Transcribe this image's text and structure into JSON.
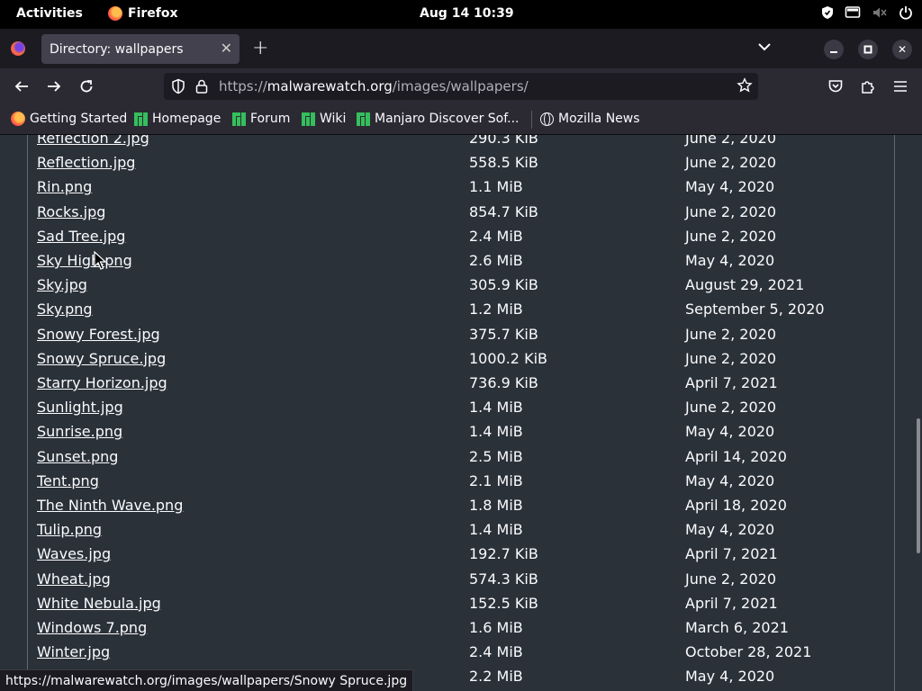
{
  "topbar": {
    "activities": "Activities",
    "app_name": "Firefox",
    "clock": "Aug 14  10:39",
    "tray_icons": [
      "shield-icon",
      "screen-icon",
      "muted-speaker-icon",
      "power-icon"
    ]
  },
  "tabs": [
    {
      "title": "Directory: wallpapers",
      "active": true
    }
  ],
  "navbar": {
    "url_prefix": "https://",
    "url_host": "malwarewatch.org",
    "url_path": "/images/wallpapers/"
  },
  "bookmarks": [
    {
      "label": "Getting Started",
      "icon": "firefox-icon"
    },
    {
      "label": "Homepage",
      "icon": "manjaro-icon"
    },
    {
      "label": "Forum",
      "icon": "manjaro-icon"
    },
    {
      "label": "Wiki",
      "icon": "manjaro-icon"
    },
    {
      "label": "Manjaro Discover Sof...",
      "icon": "manjaro-icon"
    },
    {
      "label": "Mozilla News",
      "icon": "globe-icon"
    }
  ],
  "files": [
    {
      "name": "Reflection 2.jpg",
      "size": "290.3 KiB",
      "date": "June 2, 2020"
    },
    {
      "name": "Reflection.jpg",
      "size": "558.5 KiB",
      "date": "June 2, 2020"
    },
    {
      "name": "Rin.png",
      "size": "1.1 MiB",
      "date": "May 4, 2020"
    },
    {
      "name": "Rocks.jpg",
      "size": "854.7 KiB",
      "date": "June 2, 2020"
    },
    {
      "name": "Sad Tree.jpg",
      "size": "2.4 MiB",
      "date": "June 2, 2020"
    },
    {
      "name": "Sky High.png",
      "size": "2.6 MiB",
      "date": "May 4, 2020"
    },
    {
      "name": "Sky.jpg",
      "size": "305.9 KiB",
      "date": "August 29, 2021"
    },
    {
      "name": "Sky.png",
      "size": "1.2 MiB",
      "date": "September 5, 2020"
    },
    {
      "name": "Snowy Forest.jpg",
      "size": "375.7 KiB",
      "date": "June 2, 2020"
    },
    {
      "name": "Snowy Spruce.jpg",
      "size": "1000.2 KiB",
      "date": "June 2, 2020"
    },
    {
      "name": "Starry Horizon.jpg",
      "size": "736.9 KiB",
      "date": "April 7, 2021"
    },
    {
      "name": "Sunlight.jpg",
      "size": "1.4 MiB",
      "date": "June 2, 2020"
    },
    {
      "name": "Sunrise.png",
      "size": "1.4 MiB",
      "date": "May 4, 2020"
    },
    {
      "name": "Sunset.png",
      "size": "2.5 MiB",
      "date": "April 14, 2020"
    },
    {
      "name": "Tent.png",
      "size": "2.1 MiB",
      "date": "May 4, 2020"
    },
    {
      "name": "The Ninth Wave.png",
      "size": "1.8 MiB",
      "date": "April 18, 2020"
    },
    {
      "name": "Tulip.png",
      "size": "1.4 MiB",
      "date": "May 4, 2020"
    },
    {
      "name": "Waves.jpg",
      "size": "192.7 KiB",
      "date": "April 7, 2021"
    },
    {
      "name": "Wheat.jpg",
      "size": "574.3 KiB",
      "date": "June 2, 2020"
    },
    {
      "name": "White Nebula.jpg",
      "size": "152.5 KiB",
      "date": "April 7, 2021"
    },
    {
      "name": "Windows 7.png",
      "size": "1.6 MiB",
      "date": "March 6, 2021"
    },
    {
      "name": "Winter.jpg",
      "size": "2.4 MiB",
      "date": "October 28, 2021"
    },
    {
      "name": "",
      "size": "2.2 MiB",
      "date": "May 4, 2020"
    }
  ],
  "status_url": "https://malwarewatch.org/images/wallpapers/Snowy Spruce.jpg",
  "colors": {
    "page_bg": "#2a3139",
    "chrome_bg": "#2b2a33",
    "tabstrip_bg": "#1c1b22",
    "manjaro_green": "#35bf5c"
  }
}
